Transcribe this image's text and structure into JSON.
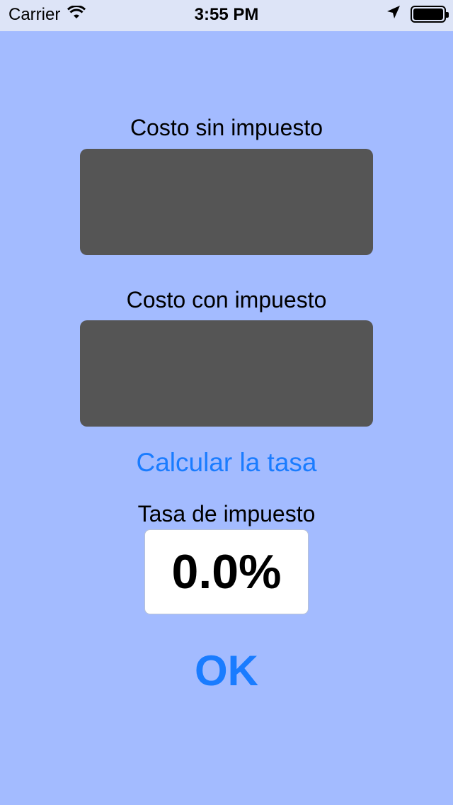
{
  "status_bar": {
    "carrier": "Carrier",
    "time": "3:55 PM"
  },
  "form": {
    "cost_without_tax_label": "Costo sin impuesto",
    "cost_without_tax_value": "",
    "cost_with_tax_label": "Costo con impuesto",
    "cost_with_tax_value": "",
    "calculate_button_label": "Calcular la tasa",
    "tax_rate_label": "Tasa de impuesto",
    "tax_rate_value": "0.0%",
    "ok_button_label": "OK"
  },
  "colors": {
    "background": "#a3bbff",
    "status_bar": "#dde4f7",
    "input_fill": "#555555",
    "accent": "#1a7cff"
  }
}
